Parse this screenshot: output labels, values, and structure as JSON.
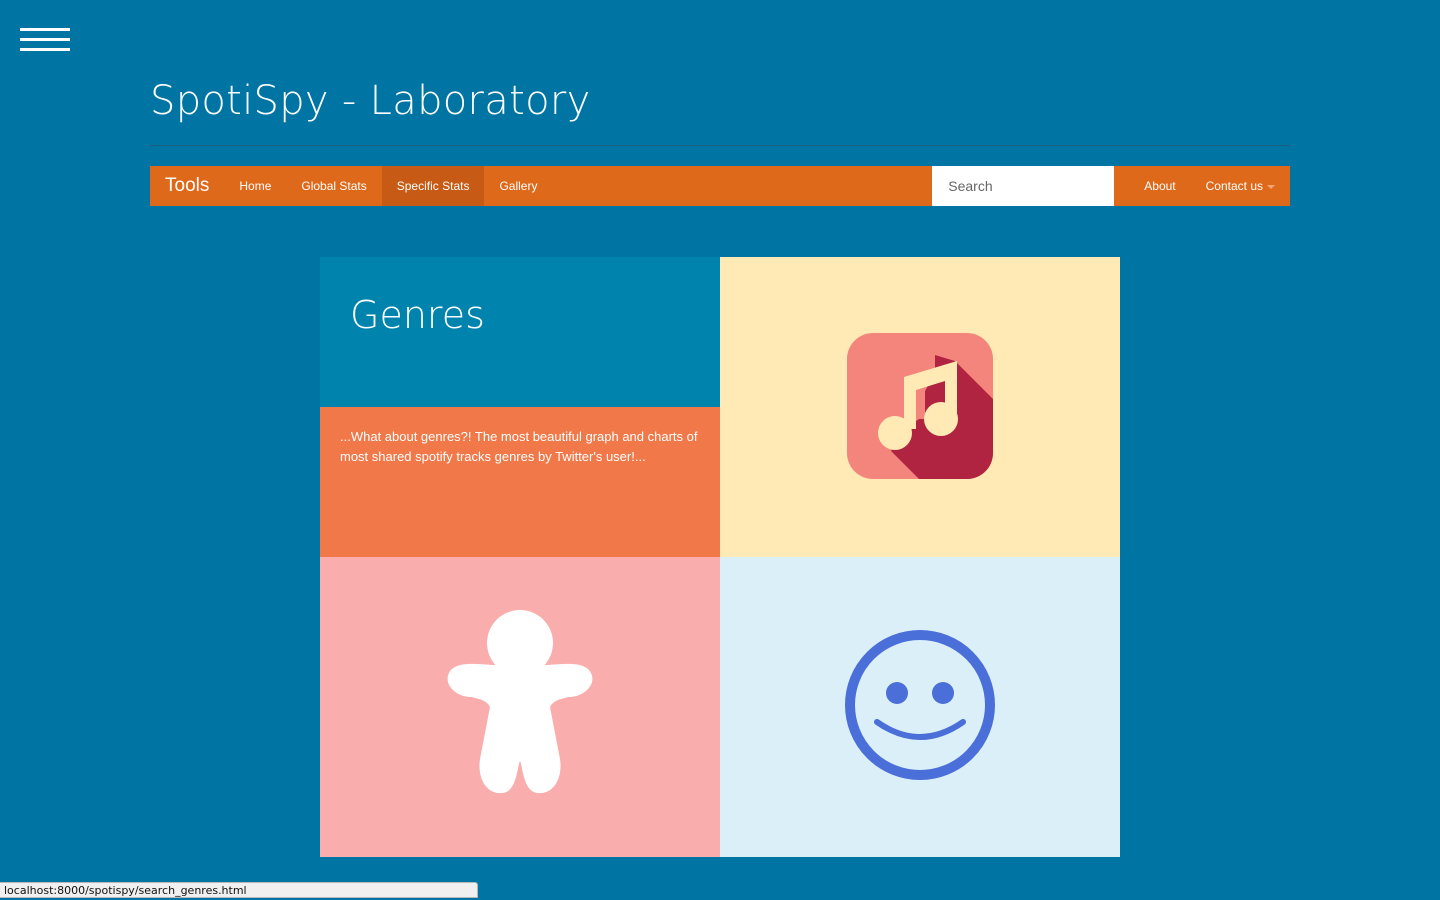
{
  "site": {
    "title": "SpotiSpy - Laboratory"
  },
  "navbar": {
    "brand": "Tools",
    "links": [
      "Home",
      "Global Stats",
      "Specific Stats",
      "Gallery"
    ],
    "active": "Specific Stats",
    "search": {
      "placeholder": "Search",
      "value": ""
    },
    "right_links": {
      "about": "About",
      "contact": "Contact us"
    }
  },
  "panel": {
    "title": "Genres",
    "description": "...What about genres?! The most beautiful graph and charts of most shared spotify tracks genres by Twitter's user!...",
    "tiles": [
      {
        "icon": "music-note-icon",
        "background": "#ffeab5"
      },
      {
        "icon": "gingerbread-man-icon",
        "background": "#f9adac"
      },
      {
        "icon": "smiley-face-icon",
        "background": "#dbeff8"
      }
    ]
  },
  "status_bar": {
    "url": "localhost:8000/spotispy/search_genres.html"
  },
  "colors": {
    "page_background": "#0074a2",
    "navbar": "#df691a",
    "navbar_active": "#c75a14",
    "title_tile": "#0083ad",
    "description_tile": "#f17848"
  }
}
